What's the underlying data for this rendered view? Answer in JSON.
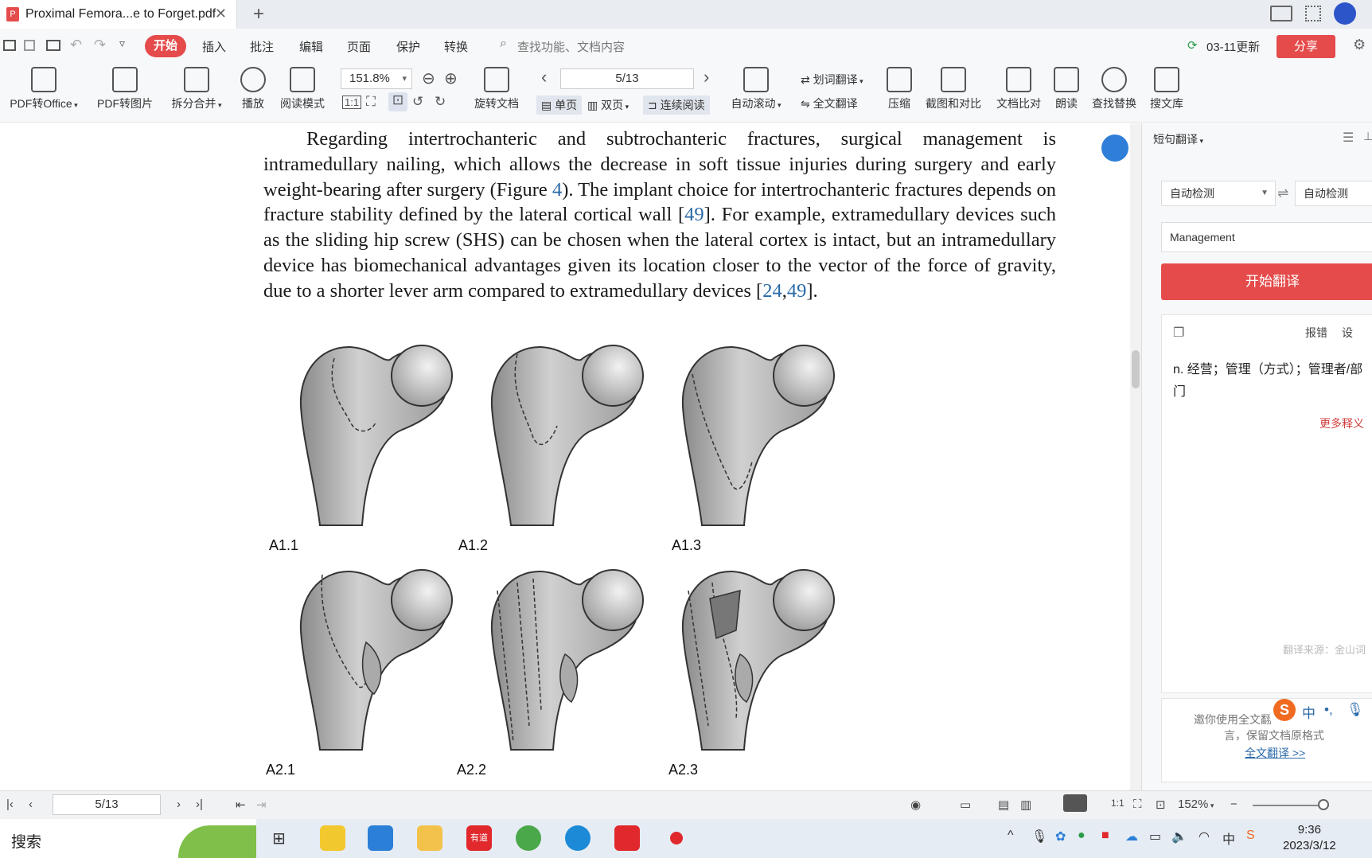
{
  "window": {
    "tab_title": "Proximal Femora...e to Forget.pdf",
    "new_tab": "+"
  },
  "menu": {
    "start": "开始",
    "items": [
      "插入",
      "批注",
      "编辑",
      "页面",
      "保护",
      "转换"
    ],
    "search_placeholder": "查找功能、文档内容",
    "update": "03-11更新",
    "share": "分享"
  },
  "ribbon": {
    "pdf_to_office": "PDF转Office",
    "pdf_to_image": "PDF转图片",
    "split_merge": "拆分合并",
    "play": "播放",
    "read_mode": "阅读模式",
    "zoom": "151.8%",
    "rotate": "旋转文档",
    "page": "5/13",
    "single_page": "单页",
    "double_page": "双页",
    "continuous": "连续阅读",
    "auto_scroll": "自动滚动",
    "word_translate": "划词翻译",
    "full_translate": "全文翻译",
    "compress": "压缩",
    "screenshot_compare": "截图和对比",
    "doc_compare": "文档比对",
    "read_aloud": "朗读",
    "find_replace": "查找替换",
    "library": "搜文库"
  },
  "document": {
    "paragraph_parts": [
      "Regarding intertrochanteric and subtrochanteric fractures, surgical management is intramedullary nailing, which allows the decrease in soft tissue injuries during surgery and early weight-bearing after surgery (Figure ",
      "4",
      "). The implant choice for intertrochanteric fractures depends on fracture stability defined by the lateral cortical wall [",
      "49",
      "]. For example, extramedullary devices such as the sliding hip screw (SHS) can be chosen when the lateral cortex is intact, but an intramedullary device has biomechanical advantages given its location closer to the vector of the force of gravity, due to a shorter lever arm compared to extramedullary devices [",
      "24",
      ",",
      "49",
      "]."
    ],
    "figure_labels": [
      "A1.1",
      "A1.2",
      "A1.3",
      "A2.1",
      "A2.2",
      "A2.3"
    ]
  },
  "panel": {
    "title": "短句翻译",
    "source_lang": "自动检测",
    "target_lang": "自动检测",
    "input_text": "Management",
    "translate_button": "开始翻译",
    "report": "报错",
    "settings": "设",
    "result_line1": "n. 经营；管理（方式）；管理者/部",
    "result_line2": "门",
    "more": "更多释义",
    "source_note": "翻译来源：金山词",
    "invite_line1": "邀你使用全文翻",
    "invite_line2": "言，保留文档原格式",
    "full_translate_link": "全文翻译 >>"
  },
  "status": {
    "page": "5/13",
    "zoom": "152%"
  },
  "taskbar": {
    "search": "搜索",
    "youdao": "有道",
    "time": "9:36",
    "date": "2023/3/12",
    "ime_lang": "中"
  }
}
